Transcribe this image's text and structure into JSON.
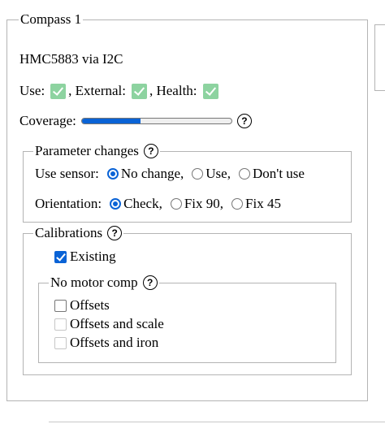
{
  "compass": {
    "legend": "Compass 1",
    "device": "HMC5883 via I2C",
    "status": {
      "use_label": "Use:",
      "external_label": ", External:",
      "health_label": ", Health:",
      "use_checked": true,
      "external_checked": true,
      "health_checked": true,
      "check_color": "#8dd3a0"
    },
    "coverage": {
      "label": "Coverage:",
      "fraction": 0.39,
      "fill_color": "#0a63d6"
    },
    "help_glyph": "?"
  },
  "parameter_changes": {
    "legend": "Parameter changes",
    "use_sensor": {
      "label": "Use sensor:",
      "options": [
        "No change,",
        "Use,",
        "Don't use"
      ],
      "selected": 0
    },
    "orientation": {
      "label": "Orientation:",
      "options": [
        "Check,",
        "Fix 90,",
        "Fix 45"
      ],
      "selected": 0
    }
  },
  "calibrations": {
    "legend": "Calibrations",
    "existing_label": "Existing",
    "existing_checked": true,
    "motor_comp": {
      "legend": "No motor comp",
      "options": [
        {
          "label": "Offsets",
          "enabled": true,
          "checked": false
        },
        {
          "label": "Offsets and scale",
          "enabled": false,
          "checked": false
        },
        {
          "label": "Offsets and iron",
          "enabled": false,
          "checked": false
        }
      ]
    }
  }
}
